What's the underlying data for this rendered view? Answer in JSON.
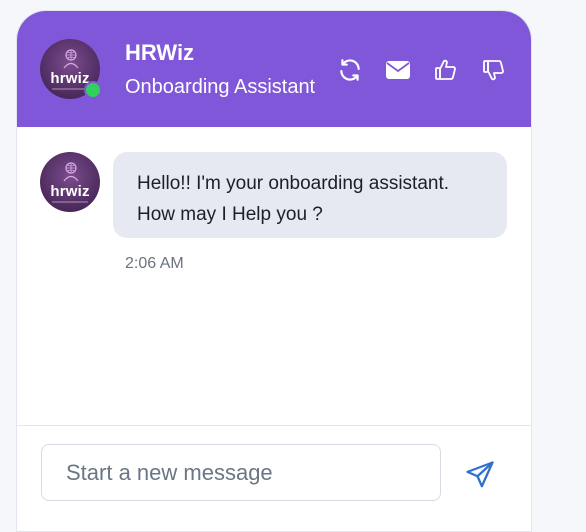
{
  "header": {
    "title": "HRWiz",
    "subtitle": "Onboarding Assistant",
    "avatar_text": "hrwiz",
    "status": "online",
    "status_color": "#2fd05c",
    "background_color": "#7f57d8",
    "actions": [
      {
        "name": "refresh",
        "icon": "refresh-icon"
      },
      {
        "name": "email",
        "icon": "envelope-icon"
      },
      {
        "name": "like",
        "icon": "thumbs-up-icon"
      },
      {
        "name": "dislike",
        "icon": "thumbs-down-icon"
      }
    ]
  },
  "messages": [
    {
      "sender": "bot",
      "avatar_text": "hrwiz",
      "lines": [
        "Hello!! I'm your onboarding assistant.",
        "How may I Help you ?"
      ],
      "time": "2:06 AM"
    }
  ],
  "composer": {
    "placeholder": "Start a new message",
    "value": "",
    "send_icon": "paper-plane-icon",
    "accent_color": "#2f6fd0"
  }
}
